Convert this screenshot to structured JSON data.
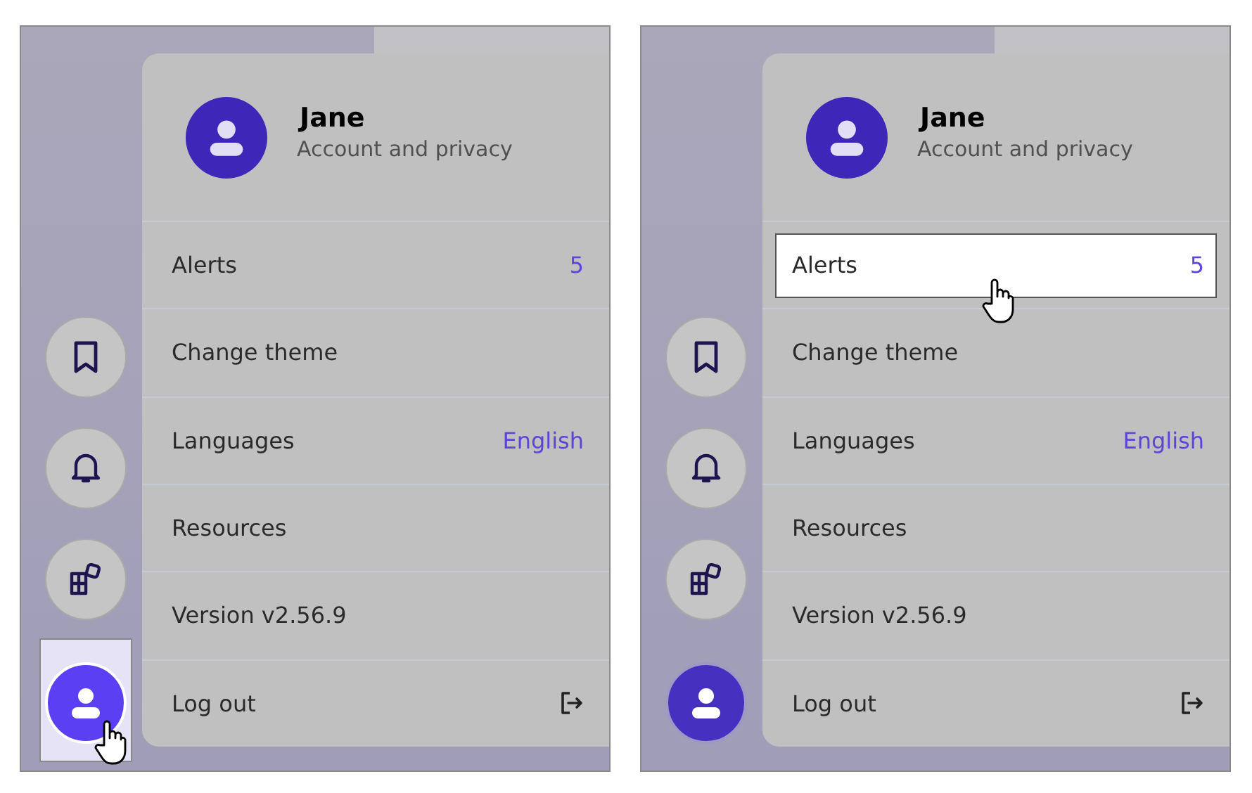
{
  "panels": [
    {
      "sidebar": [
        {
          "kind": "bookmark"
        },
        {
          "kind": "bell"
        },
        {
          "kind": "apps"
        }
      ],
      "profile_button": {
        "hovered": true
      },
      "menu": {
        "name": "Jane",
        "subtitle": "Account and privacy",
        "items": [
          {
            "kind": "count",
            "label": "Alerts",
            "value": "5",
            "hovered": false
          },
          {
            "kind": "plain",
            "label": "Change theme",
            "hovered": false
          },
          {
            "kind": "value",
            "label": "Languages",
            "value": "English",
            "hovered": false
          },
          {
            "kind": "plain",
            "label": "Resources",
            "hovered": false
          },
          {
            "kind": "plain",
            "label": "Version v2.56.9",
            "hovered": false
          },
          {
            "kind": "logout",
            "label": "Log out",
            "hovered": false
          }
        ]
      }
    },
    {
      "sidebar": [
        {
          "kind": "bookmark"
        },
        {
          "kind": "bell"
        },
        {
          "kind": "apps"
        }
      ],
      "profile_button": {
        "hovered": false
      },
      "menu": {
        "name": "Jane",
        "subtitle": "Account and privacy",
        "items": [
          {
            "kind": "count",
            "label": "Alerts",
            "value": "5",
            "hovered": true
          },
          {
            "kind": "plain",
            "label": "Change theme",
            "hovered": false
          },
          {
            "kind": "value",
            "label": "Languages",
            "value": "English",
            "hovered": false
          },
          {
            "kind": "plain",
            "label": "Resources",
            "hovered": false
          },
          {
            "kind": "plain",
            "label": "Version v2.56.9",
            "hovered": false
          },
          {
            "kind": "logout",
            "label": "Log out",
            "hovered": false
          }
        ]
      }
    }
  ]
}
